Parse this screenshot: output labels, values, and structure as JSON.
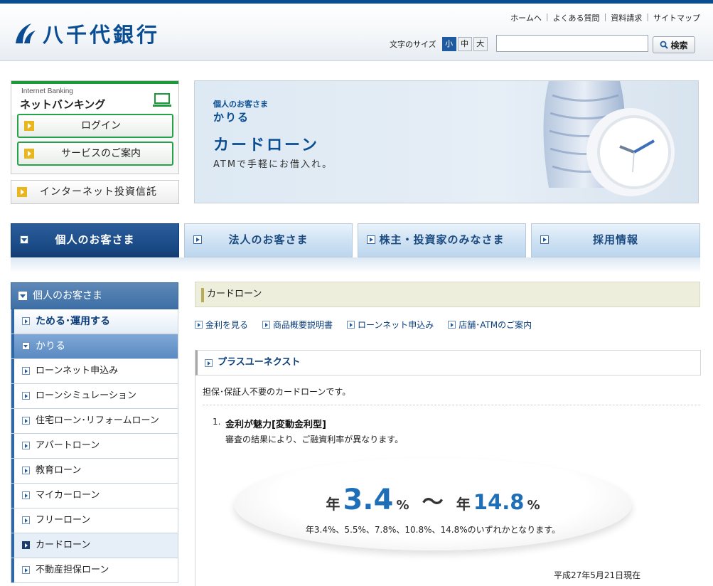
{
  "header": {
    "bank_name": "八千代銀行",
    "util_links": [
      "ホームへ",
      "よくある質問",
      "資料請求",
      "サイトマップ"
    ],
    "font_size_label": "文字のサイズ",
    "font_sizes": [
      "小",
      "中",
      "大"
    ],
    "search_button": "検索",
    "search_value": ""
  },
  "internet_banking": {
    "small_label": "Internet Banking",
    "title": "ネットバンキング",
    "login": "ログイン",
    "service": "サービスのご案内",
    "invest": "インターネット投資信託"
  },
  "banner": {
    "sub1": "個人のお客さま",
    "sub2": "かりる",
    "title": "カードローン",
    "desc": "ATMで手軽にお借入れ。"
  },
  "global_nav": [
    "個人のお客さま",
    "法人のお客さま",
    "株主・投資家のみなさま",
    "採用情報"
  ],
  "sidebar": {
    "head": "個人のお客さま",
    "items": [
      {
        "label": "ためる･運用する",
        "kind": "level1"
      },
      {
        "label": "かりる",
        "kind": "open"
      },
      {
        "label": "ローンネット申込み",
        "kind": "child"
      },
      {
        "label": "ローンシミュレーション",
        "kind": "child"
      },
      {
        "label": "住宅ローン･リフォームローン",
        "kind": "child"
      },
      {
        "label": "アパートローン",
        "kind": "child"
      },
      {
        "label": "教育ローン",
        "kind": "child"
      },
      {
        "label": "マイカーローン",
        "kind": "child"
      },
      {
        "label": "フリーローン",
        "kind": "child"
      },
      {
        "label": "カードローン",
        "kind": "current"
      },
      {
        "label": "不動産担保ローン",
        "kind": "child"
      }
    ]
  },
  "main": {
    "page_title": "カードローン",
    "sub_links": [
      "金利を見る",
      "商品概要説明書",
      "ローンネット申込み",
      "店舗･ATMのご案内"
    ],
    "product_title": "プラスユーネクスト",
    "product_desc": "担保･保証人不要のカードローンです。",
    "feature_num": "1.",
    "feature_title": "金利が魅力[変動金利型]",
    "feature_desc": "審査の結果により、ご融資利率が異なります。",
    "rate_prefix": "年",
    "rate_low": "3.4",
    "rate_unit": "%",
    "rate_tilde": "〜",
    "rate_high": "14.8",
    "rate_note": "年3.4%、5.5%、7.8%、10.8%、14.8%のいずれかとなります。",
    "as_of": "平成27年5月21日現在"
  },
  "colors": {
    "brand": "#0a4d92",
    "ib_green": "#1b9a3a",
    "rate_blue": "#1f6fb8"
  }
}
